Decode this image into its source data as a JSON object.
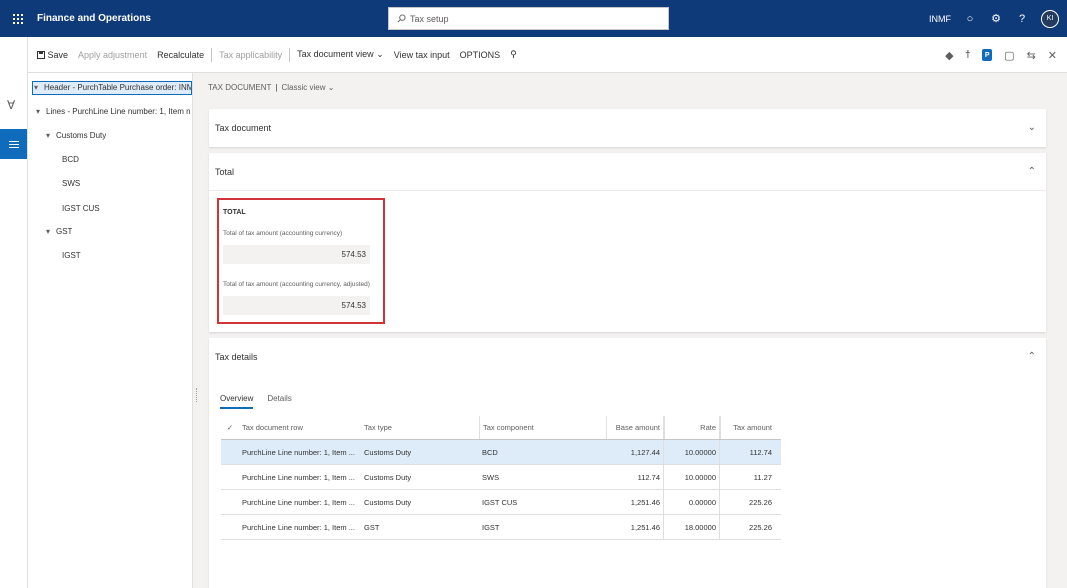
{
  "app": {
    "title": "Finance and Operations",
    "search_placeholder": "Tax setup",
    "company": "INMF",
    "avatar_initials": "KI"
  },
  "actions": [
    {
      "label": "Save",
      "disabled": false
    },
    {
      "label": "Apply adjustment",
      "disabled": true
    },
    {
      "label": "Recalculate",
      "disabled": false
    },
    {
      "label": "Tax applicability",
      "disabled": true
    },
    {
      "label": "Tax document view",
      "disabled": false
    },
    {
      "label": "View tax input",
      "disabled": false
    },
    {
      "label": "OPTIONS",
      "disabled": false
    }
  ],
  "tree": {
    "header": "Header - PurchTable Purchase order: INM",
    "lines": "Lines - PurchLine Line number: 1, Item n",
    "customs_duty": "Customs Duty",
    "bcd": "BCD",
    "sws": "SWS",
    "igst_cus": "IGST CUS",
    "gst": "GST",
    "igst": "IGST"
  },
  "breadcrumb": {
    "left": "TAX DOCUMENT",
    "right": "Classic view"
  },
  "sections": {
    "tax_document": "Tax document",
    "total": "Total",
    "tax_details": "Tax details"
  },
  "total_panel": {
    "heading": "TOTAL",
    "label1": "Total of tax amount (accounting currency)",
    "value1": "574.53",
    "label2": "Total of tax amount (accounting currency, adjusted)",
    "value2": "574.53"
  },
  "tabs": [
    "Overview",
    "Details"
  ],
  "grid": {
    "columns": [
      "Tax document row",
      "Tax type",
      "Tax component",
      "Base amount",
      "Rate",
      "Tax amount"
    ],
    "rows": [
      {
        "row": "PurchLine Line number: 1, Item ...",
        "type": "Customs Duty",
        "component": "BCD",
        "base": "1,127.44",
        "rate": "10.00000",
        "amount": "112.74"
      },
      {
        "row": "PurchLine Line number: 1, Item ...",
        "type": "Customs Duty",
        "component": "SWS",
        "base": "112.74",
        "rate": "10.00000",
        "amount": "11.27"
      },
      {
        "row": "PurchLine Line number: 1, Item ...",
        "type": "Customs Duty",
        "component": "IGST CUS",
        "base": "1,251.46",
        "rate": "0.00000",
        "amount": "225.26"
      },
      {
        "row": "PurchLine Line number: 1, Item ...",
        "type": "GST",
        "component": "IGST",
        "base": "1,251.46",
        "rate": "18.00000",
        "amount": "225.26"
      }
    ]
  }
}
